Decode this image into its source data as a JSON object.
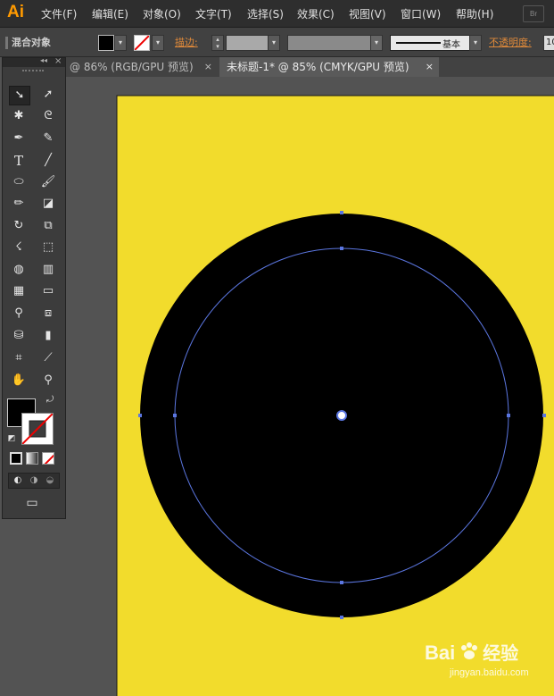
{
  "app": {
    "logo": "Ai",
    "bridge": "Br"
  },
  "menu": [
    "文件(F)",
    "编辑(E)",
    "对象(O)",
    "文字(T)",
    "选择(S)",
    "效果(C)",
    "视图(V)",
    "窗口(W)",
    "帮助(H)"
  ],
  "control": {
    "selection_label": "混合对象",
    "stroke_label": "描边",
    "stroke_profile": "基本",
    "opacity_label": "不透明度",
    "opacity_value": "10"
  },
  "tabs": [
    {
      "label": "@ 86% (RGB/GPU 预览)",
      "close": "×"
    },
    {
      "label": "未标题-1* @ 85% (CMYK/GPU 预览)",
      "close": "×"
    }
  ],
  "toolbox": {
    "collapse": "◂◂",
    "close": "×"
  },
  "colors": {
    "artboard": "#f2dc2c",
    "fill": "#000000",
    "selection": "#5b76e0",
    "accent": "#ff9a00"
  },
  "watermark": {
    "brand": "Bai",
    "brand_suffix": "经验",
    "url": "jingyan.baidu.com"
  }
}
